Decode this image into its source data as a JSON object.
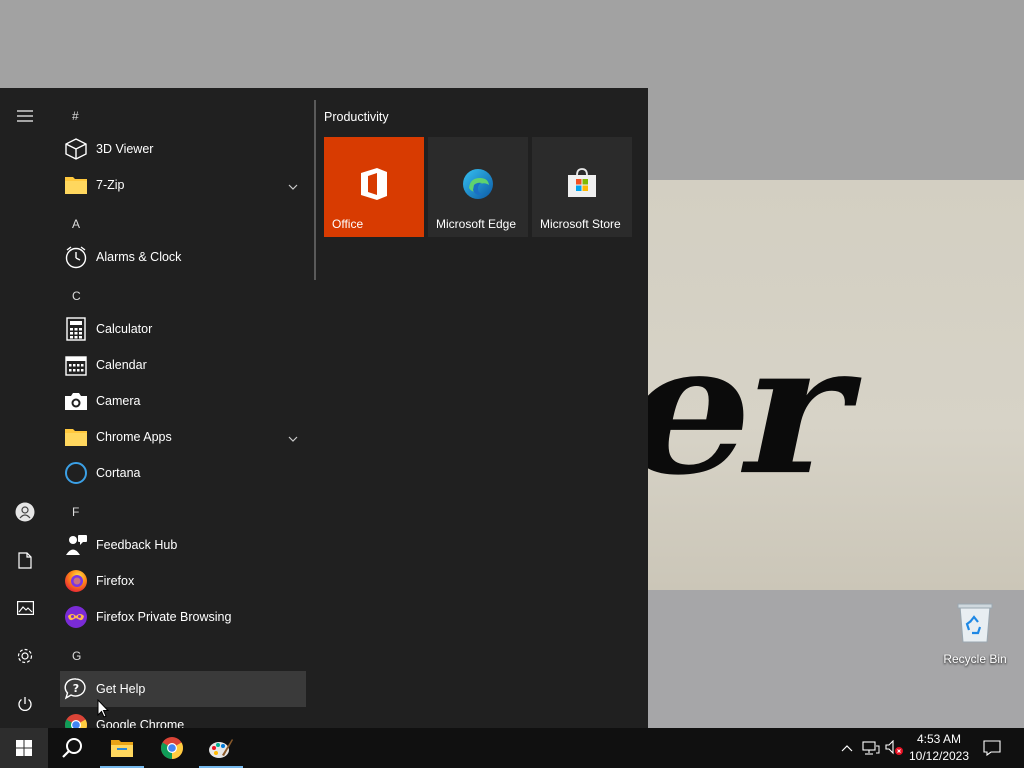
{
  "desktop": {
    "recycle_bin_label": "Recycle Bin",
    "wallpaper_text": "er"
  },
  "start_menu": {
    "sections": [
      {
        "letter": "#",
        "apps": [
          {
            "name": "3D Viewer",
            "icon": "cube-icon"
          },
          {
            "name": "7-Zip",
            "icon": "folder-icon",
            "expandable": true
          }
        ]
      },
      {
        "letter": "A",
        "apps": [
          {
            "name": "Alarms & Clock",
            "icon": "clock-icon"
          }
        ]
      },
      {
        "letter": "C",
        "apps": [
          {
            "name": "Calculator",
            "icon": "calculator-icon"
          },
          {
            "name": "Calendar",
            "icon": "calendar-icon"
          },
          {
            "name": "Camera",
            "icon": "camera-icon"
          },
          {
            "name": "Chrome Apps",
            "icon": "folder-icon",
            "expandable": true
          },
          {
            "name": "Cortana",
            "icon": "cortana-icon"
          }
        ]
      },
      {
        "letter": "F",
        "apps": [
          {
            "name": "Feedback Hub",
            "icon": "feedback-icon"
          },
          {
            "name": "Firefox",
            "icon": "firefox-icon"
          },
          {
            "name": "Firefox Private Browsing",
            "icon": "firefox-private-icon"
          }
        ]
      },
      {
        "letter": "G",
        "apps": [
          {
            "name": "Get Help",
            "icon": "help-icon",
            "hovered": true
          },
          {
            "name": "Google Chrome",
            "icon": "chrome-icon"
          }
        ]
      }
    ],
    "tile_group": {
      "title": "Productivity",
      "tiles": [
        {
          "label": "Office",
          "icon": "office-icon",
          "color": "#d83b01"
        },
        {
          "label": "Microsoft Edge",
          "icon": "edge-icon",
          "color": "#2b2b2b"
        },
        {
          "label": "Microsoft Store",
          "icon": "store-icon",
          "color": "#2b2b2b"
        }
      ]
    },
    "rail": [
      "menu-icon",
      "user-icon",
      "documents-icon",
      "pictures-icon",
      "settings-icon",
      "power-icon"
    ]
  },
  "taskbar": {
    "apps": [
      "windows-start-icon",
      "search-icon",
      "file-explorer-icon",
      "chrome-icon",
      "paint-icon"
    ],
    "clock": {
      "time": "4:53 AM",
      "date": "10/12/2023"
    },
    "tray": [
      "chevron-up-icon",
      "network-icon",
      "volume-muted-icon",
      "notification-icon"
    ]
  },
  "colors": {
    "accent": "#76b9ed",
    "start_bg": "#202020",
    "taskbar_bg": "#101010",
    "office_tile": "#d83b01"
  }
}
